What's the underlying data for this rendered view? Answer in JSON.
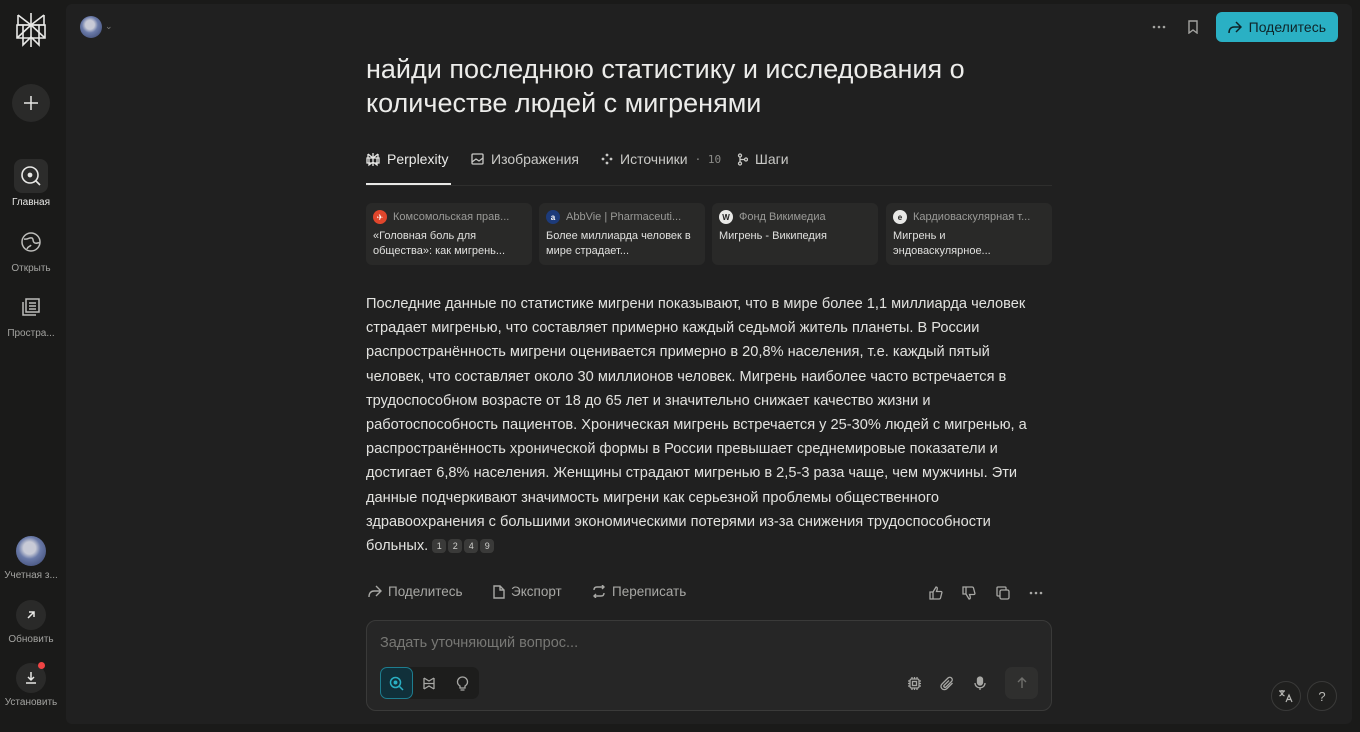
{
  "rail": {
    "items": [
      {
        "label": "Главная"
      },
      {
        "label": "Открыть"
      },
      {
        "label": "Простра..."
      }
    ],
    "bottom": [
      {
        "label": "Учетная з..."
      },
      {
        "label": "Обновить"
      },
      {
        "label": "Установить"
      }
    ]
  },
  "header": {
    "share_label": "Поделитесь"
  },
  "thread": {
    "title": "найди последнюю статистику и исследования о количестве людей с мигренями"
  },
  "tabs": [
    {
      "label": "Perplexity"
    },
    {
      "label": "Изображения"
    },
    {
      "label": "Источники",
      "count": "· 10"
    },
    {
      "label": "Шаги"
    }
  ],
  "sources": [
    {
      "site": "Комсомольская прав...",
      "title": "«Головная боль для общества»: как мигрень...",
      "fav_color": "#e0462c",
      "fav_glyph": "✈"
    },
    {
      "site": "AbbVie | Pharmaceuti...",
      "title": "Более миллиарда человек в мире страдает...",
      "fav_color": "#1d3b7a",
      "fav_glyph": "a"
    },
    {
      "site": "Фонд Викимедиа",
      "title": "Мигрень - Википедия",
      "fav_color": "#e8e8e6",
      "fav_glyph": "W"
    },
    {
      "site": "Кардиоваскулярная т...",
      "title": "Мигрень и эндоваскулярное...",
      "fav_color": "#e8e8e6",
      "fav_glyph": "e"
    }
  ],
  "answer": {
    "text": "Последние данные по статистике мигрени показывают, что в мире более 1,1 миллиарда человек страдает мигренью, что составляет примерно каждый седьмой житель планеты. В России распространённость мигрени оценивается примерно в 20,8% населения, т.е. каждый пятый человек, что составляет около 30 миллионов человек. Мигрень наиболее часто встречается в трудоспособном возрасте от 18 до 65 лет и значительно снижает качество жизни и работоспособность пациентов. Хроническая мигрень встречается у 25-30% людей с мигренью, а распространённость хронической формы в России превышает среднемировые показатели и достигает 6,8% населения. Женщины страдают мигренью в 2,5-3 раза чаще, чем мужчины. Эти данные подчеркивают значимость мигрени как серьезной проблемы общественного здравоохранения с большими экономическими потерями из-за снижения трудоспособности больных.",
    "citations": [
      "1",
      "2",
      "4",
      "9"
    ]
  },
  "actions": {
    "share": "Поделитесь",
    "export": "Экспорт",
    "rewrite": "Переписать"
  },
  "followup": {
    "placeholder": "Задать уточняющий вопрос..."
  },
  "colors": {
    "accent": "#2ab0c4",
    "notification": "#ef4444"
  }
}
